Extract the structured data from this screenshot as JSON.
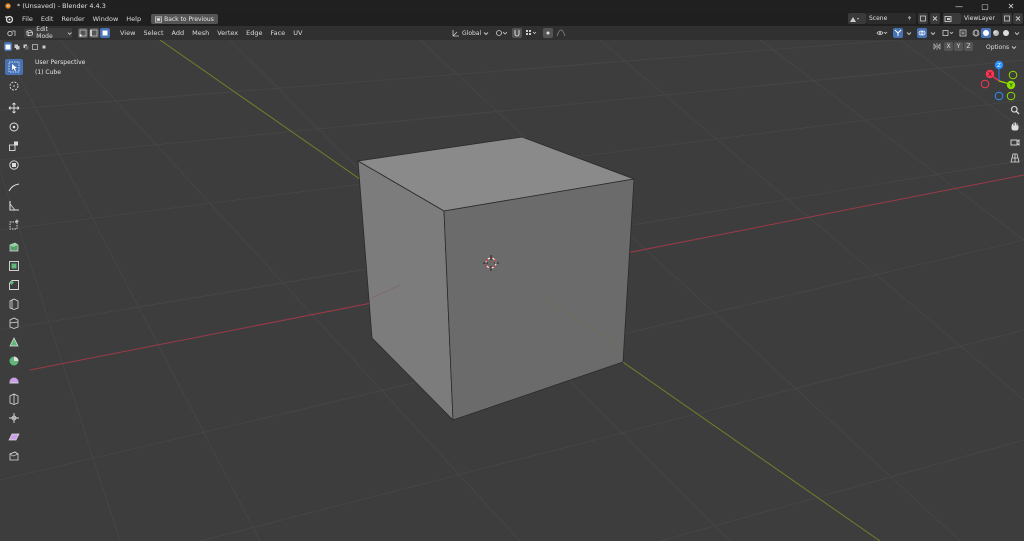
{
  "window": {
    "title": "* (Unsaved) - Blender 4.4.3",
    "minimize": "—",
    "maximize": "▢",
    "close": "✕"
  },
  "menubar": {
    "items": [
      "File",
      "Edit",
      "Render",
      "Window",
      "Help"
    ],
    "back_button": "Back to Previous",
    "scene_label": "Scene",
    "view_layer_label": "ViewLayer"
  },
  "header": {
    "mode": "Edit Mode",
    "menus": [
      "View",
      "Select",
      "Add",
      "Mesh",
      "Vertex",
      "Edge",
      "Face",
      "UV"
    ],
    "transform_orientation": "Global",
    "axis_x": "X",
    "axis_y": "Y",
    "axis_z": "Z",
    "options": "Options"
  },
  "viewport": {
    "view_name": "User Perspective",
    "object_name": "(1) Cube"
  },
  "gizmo": {
    "x": "X",
    "y": "Y",
    "z": "Z"
  },
  "colors": {
    "accent": "#4772b3",
    "axis_x": "#ff3352",
    "axis_y": "#8bdc00",
    "axis_z": "#2890ff",
    "viewport_bg": "#3d3d3d"
  },
  "toolbar": {
    "tools": [
      "select-box",
      "cursor",
      "move",
      "rotate",
      "scale",
      "transform",
      "annotate",
      "measure",
      "add-cube",
      "extrude-region",
      "inset-faces",
      "bevel",
      "loop-cut",
      "knife",
      "poly-build",
      "spin",
      "smooth",
      "edge-slide",
      "shrink-fatten",
      "shear",
      "rip-region"
    ]
  }
}
